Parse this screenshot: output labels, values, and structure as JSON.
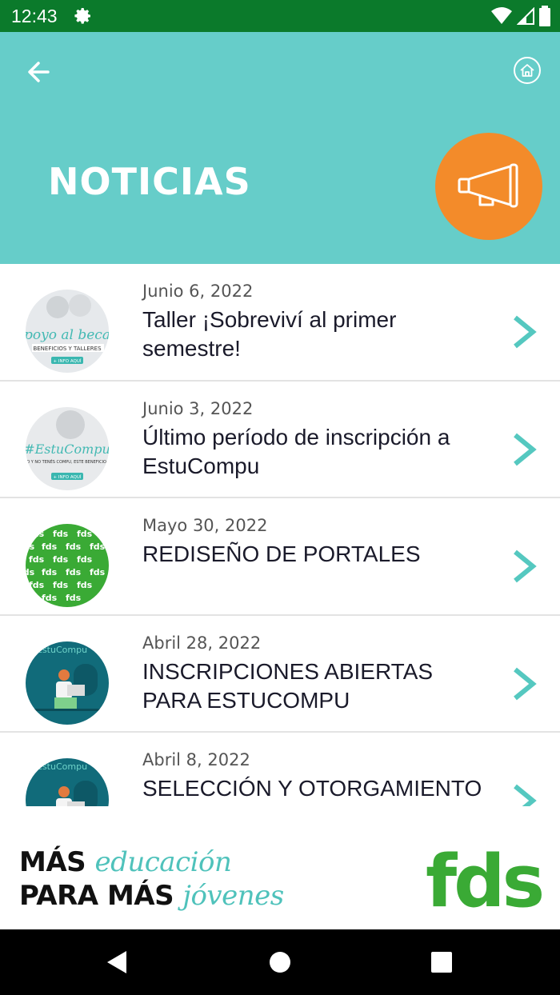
{
  "status_bar": {
    "time": "12:43"
  },
  "header": {
    "title": "NOTICIAS",
    "accent_color": "#66cdc9",
    "badge_color": "#f38b2a"
  },
  "news": [
    {
      "date": "Junio 6, 2022",
      "title": "Taller ¡Sobreviví al primer semestre!",
      "thumb_text": "poyo al beca",
      "thumb_sub": "BENEFICIOS Y TALLERES",
      "thumb_btn": "+ INFO AQUÍ"
    },
    {
      "date": "Junio 3, 2022",
      "title": "Último período de inscripción a EstuCompu",
      "thumb_text": "#EstuCompu",
      "thumb_sub": "SI SOS BECARIO Y NO TENÉS COMPU, ESTE BENEFICIO ¡ES PARA VOS!",
      "thumb_btn": "+ INFO AQUÍ"
    },
    {
      "date": "Mayo 30, 2022",
      "title": "REDISEÑO DE PORTALES",
      "thumb_text": "fds"
    },
    {
      "date": "Abril 28, 2022",
      "title": "INSCRIPCIONES ABIERTAS PARA ESTUCOMPU",
      "thumb_text": "EstuCompu"
    },
    {
      "date": "Abril 8, 2022",
      "title": "SELECCIÓN Y OTORGAMIENTO",
      "thumb_text": "EstuCompu"
    }
  ],
  "footer": {
    "line1_bold": "MÁS",
    "line1_accent": "educación",
    "line2_bold": "PARA MÁS",
    "line2_accent": "jóvenes",
    "logo": "fds"
  }
}
